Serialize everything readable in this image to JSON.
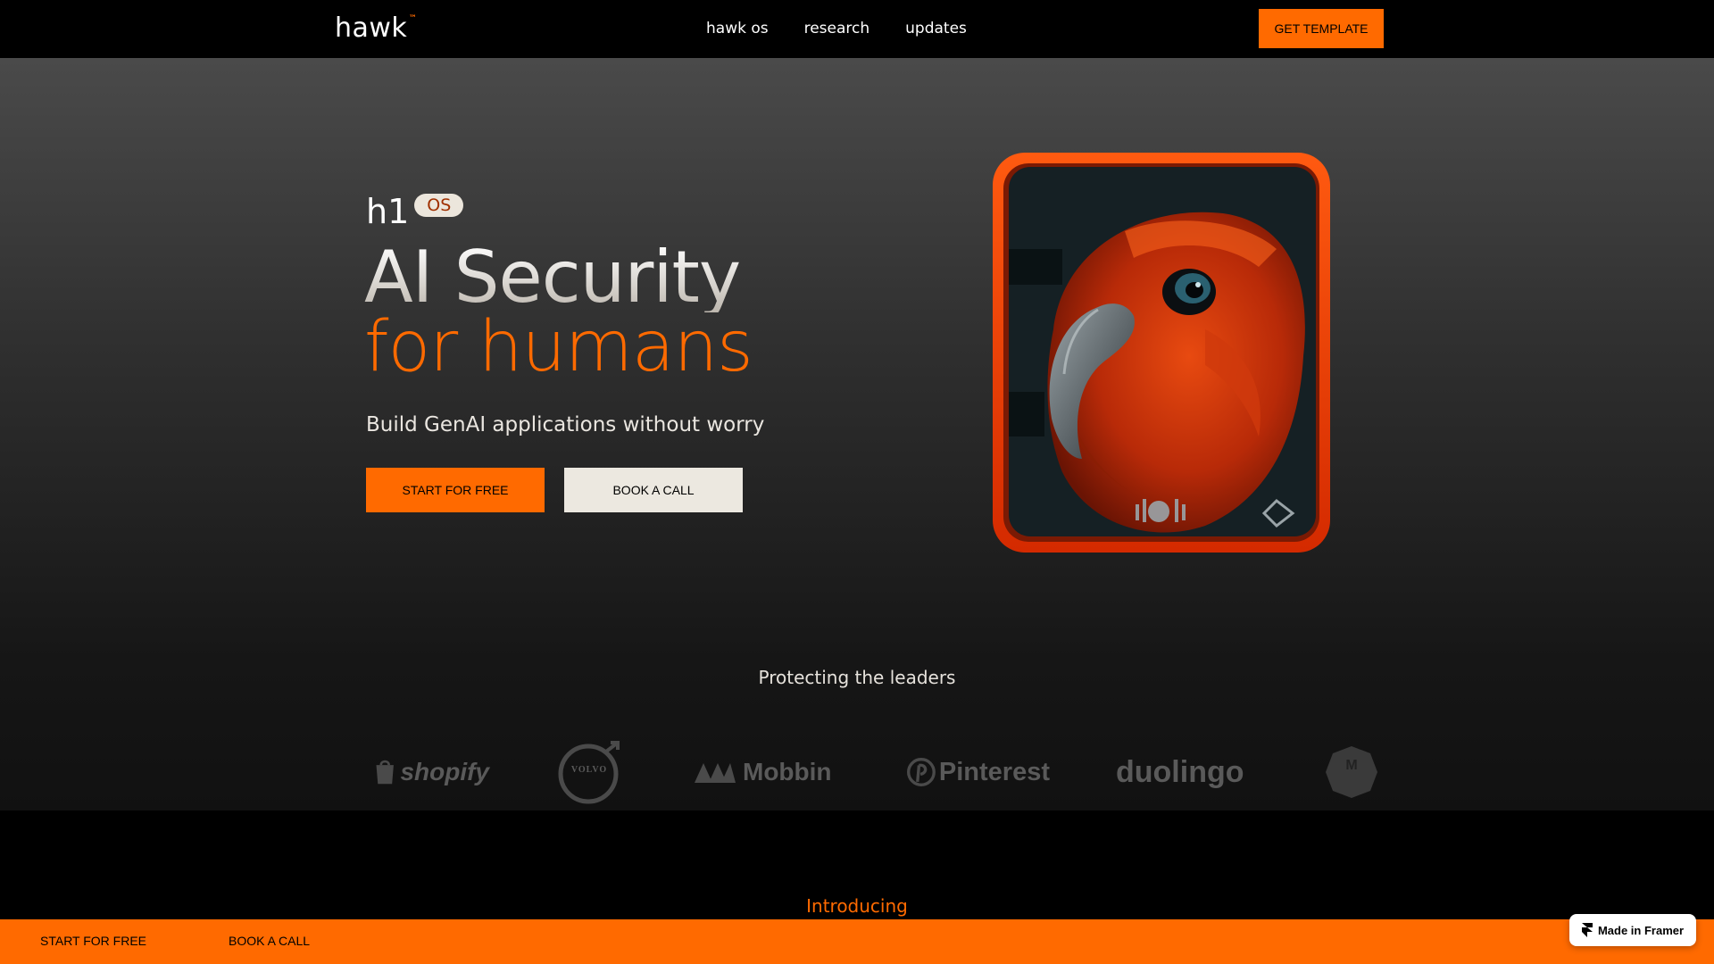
{
  "nav": {
    "logo": "hawk",
    "logo_mark": "™",
    "links": [
      "hawk os",
      "research",
      "updates"
    ],
    "cta": "GET TEMPLATE"
  },
  "hero": {
    "tag_prefix": "h1",
    "tag_pill": "OS",
    "headline_line1": "AI Security",
    "headline_line2": "for humans",
    "subhead": "Build GenAI applications without worry",
    "primary_button": "START FOR FREE",
    "secondary_button": "BOOK A CALL"
  },
  "leaders": {
    "heading": "Protecting the leaders",
    "logos": [
      "shopify",
      "VOLVO",
      "Mobbin",
      "Pinterest",
      "duolingo",
      "M"
    ]
  },
  "section": {
    "introducing": "Introducing"
  },
  "bottom_bar": {
    "start": "START FOR FREE",
    "book": "BOOK A CALL"
  },
  "badge": {
    "label": "Made in Framer"
  },
  "colors": {
    "accent": "#ff6a00",
    "cream": "#ece8e0",
    "background": "#000000"
  }
}
